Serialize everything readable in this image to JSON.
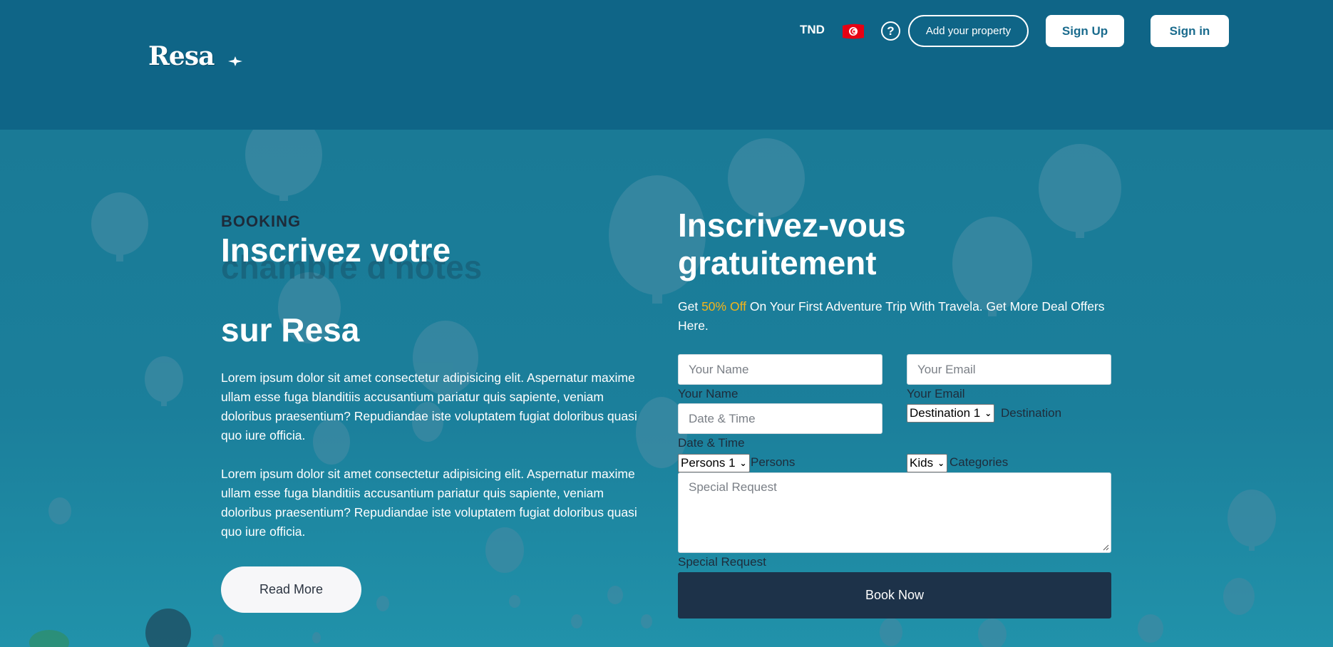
{
  "header": {
    "logo_text": "Resa",
    "currency": "TND",
    "help_label": "?",
    "add_property_label": "Add your property",
    "sign_up_label": "Sign Up",
    "sign_in_label": "Sign in"
  },
  "hero": {
    "kicker": "BOOKING",
    "title_line1": "Inscrivez votre",
    "title_line2": "chambre d'hôtes",
    "title_line3": "sur Resa",
    "paragraph1": "Lorem ipsum dolor sit amet consectetur adipisicing elit. Aspernatur maxime ullam esse fuga blanditiis accusantium pariatur quis sapiente, veniam doloribus praesentium? Repudiandae iste voluptatem fugiat doloribus quasi quo iure officia.",
    "paragraph2": "Lorem ipsum dolor sit amet consectetur adipisicing elit. Aspernatur maxime ullam esse fuga blanditiis accusantium pariatur quis sapiente, veniam doloribus praesentium? Repudiandae iste voluptatem fugiat doloribus quasi quo iure officia.",
    "read_more_label": "Read More"
  },
  "form": {
    "title": "Inscrivez-vous gratuitement",
    "offer_prefix": "Get ",
    "offer_highlight": "50% Off",
    "offer_suffix": " On Your First Adventure Trip With Travela. Get More Deal Offers Here.",
    "name_placeholder": "Your Name",
    "name_label": "Your Name",
    "email_placeholder": "Your Email",
    "email_label": "Your Email",
    "date_placeholder": "Date & Time",
    "date_label": "Date & Time",
    "destination_value": "Destination 1",
    "destination_label": "Destination",
    "persons_value": "Persons 1",
    "persons_label": "Persons",
    "categories_value": "Kids",
    "categories_label": "Categories",
    "special_request_placeholder": "Special Request",
    "special_request_label": "Special Request",
    "book_now_label": "Book Now"
  },
  "colors": {
    "header_bg": "#0f6587",
    "hero_bg": "#1a7a95",
    "highlight": "#f4b41a",
    "book_button_bg": "#1d3249",
    "flag_red": "#e70013"
  }
}
